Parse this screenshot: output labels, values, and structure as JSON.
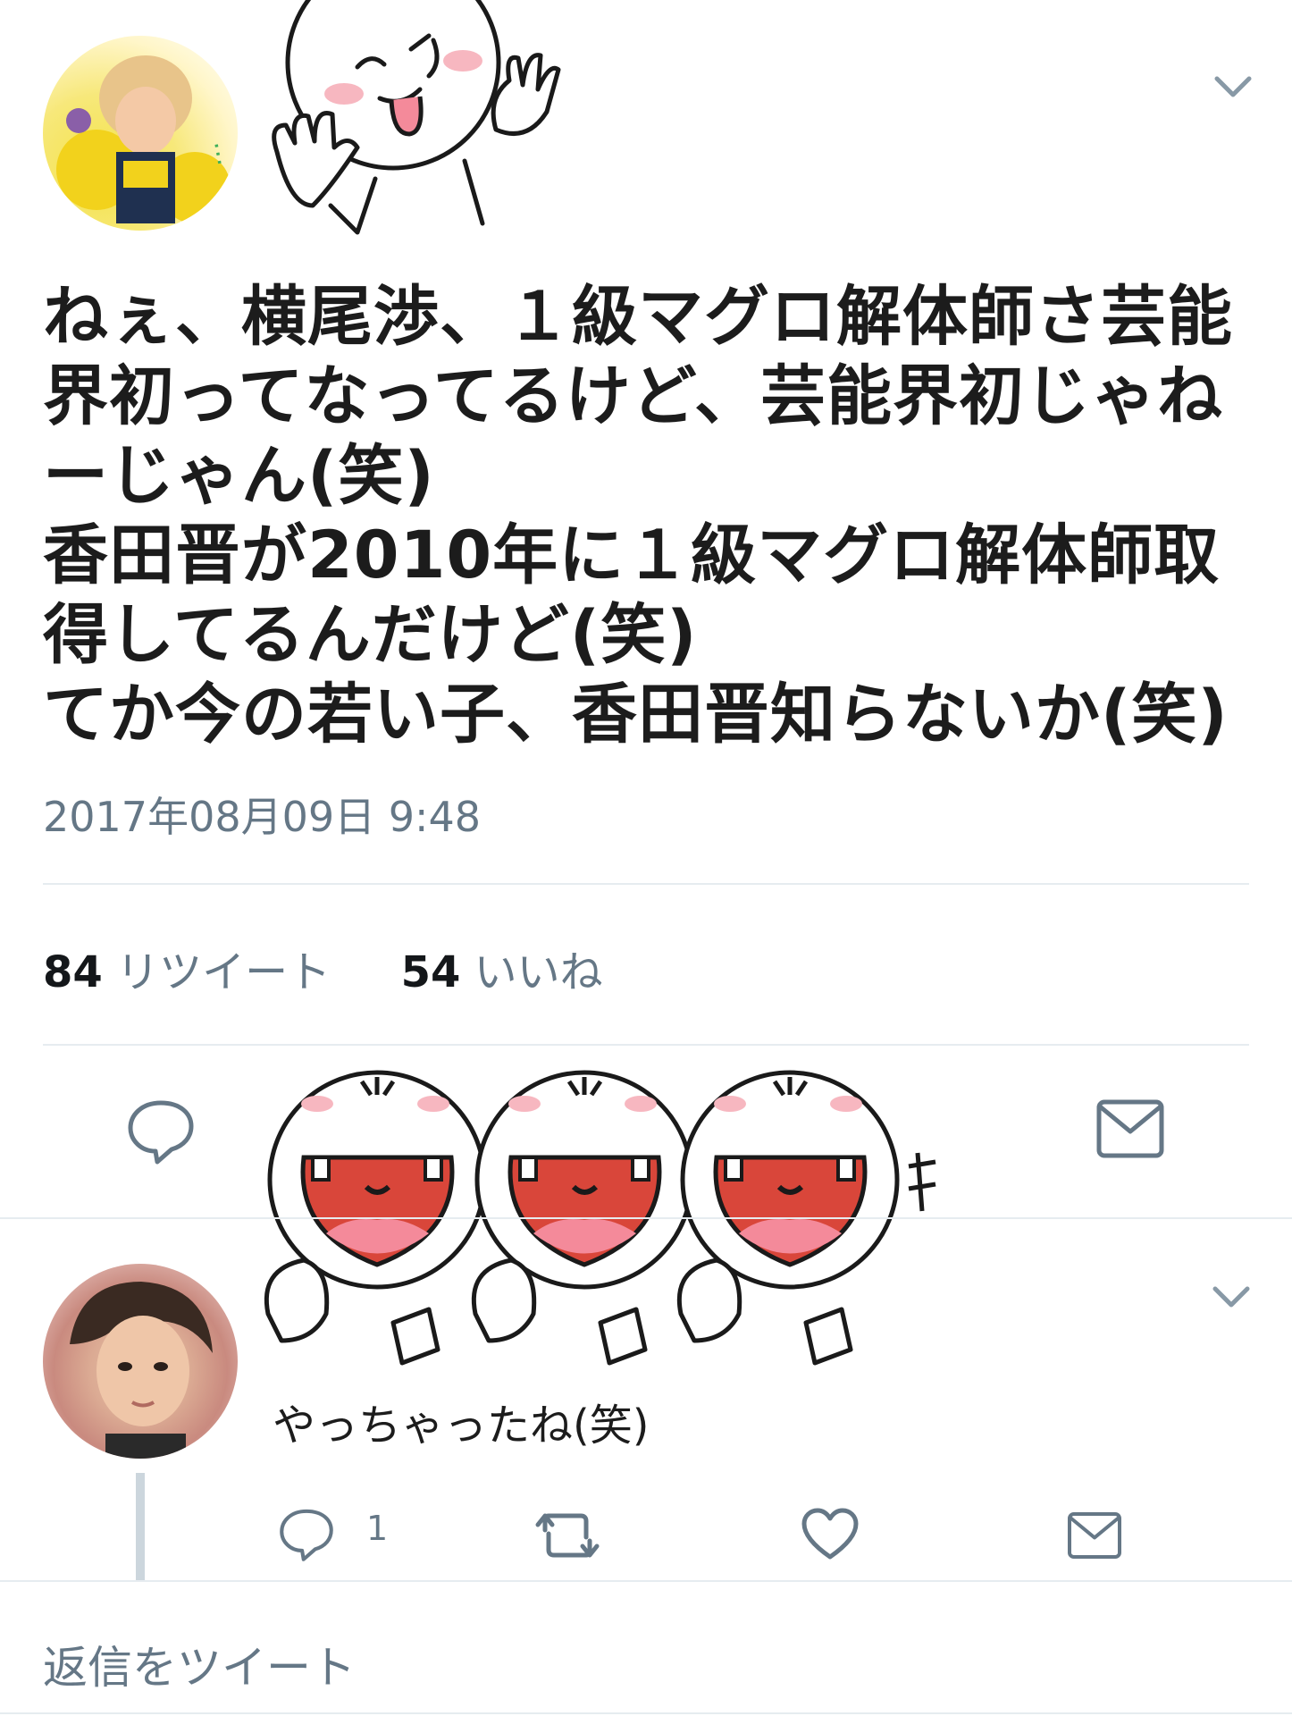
{
  "tweet": {
    "lines": [
      "ねぇ、横尾渉、１級マグロ解体師さ芸能",
      "界初ってなってるけど、芸能界初じゃね",
      "ーじゃん(笑)",
      "香田晋が2010年に１級マグロ解体師取",
      "得してるんだけど(笑)",
      "てか今の若い子、香田晋知らないか(笑)"
    ],
    "timestamp": "2017年08月09日 9:48",
    "retweet_count": "84",
    "retweet_label": "リツイート",
    "like_count": "54",
    "like_label": "いいね"
  },
  "reply": {
    "text": "やっちゃったね(笑)",
    "reply_count": "1"
  },
  "compose": {
    "placeholder": "返信をツイート"
  },
  "icons": {
    "more": "chevron-down-icon",
    "reply": "speech-bubble-icon",
    "retweet": "retweet-icon",
    "like": "heart-icon",
    "dm": "envelope-icon"
  },
  "colors": {
    "text": "#14171a",
    "secondary": "#657786",
    "divider": "#e6ecf0",
    "sticker_mouth": "#d9463a",
    "sticker_cheek": "#f7b7c0"
  }
}
